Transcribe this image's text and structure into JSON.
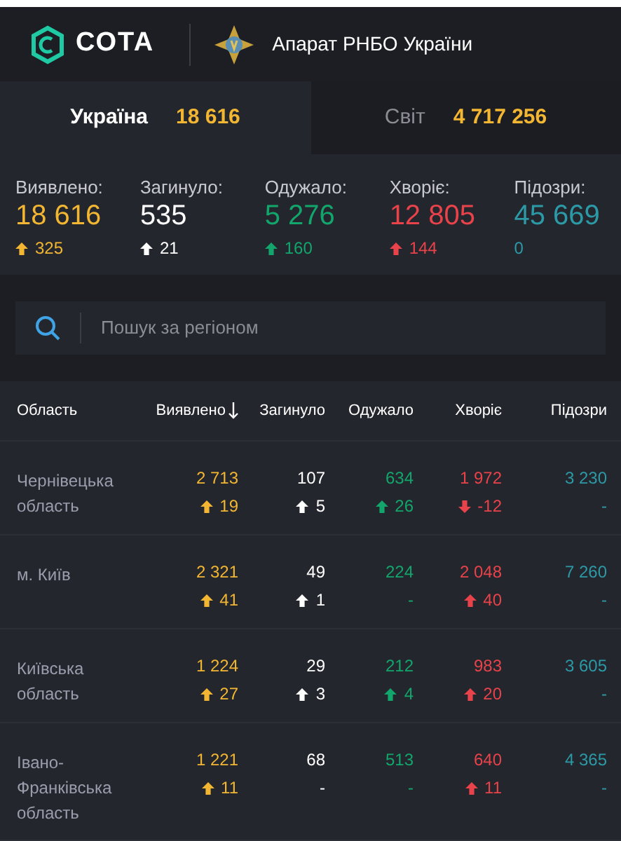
{
  "header": {
    "logo_text": "СОТА",
    "org": "Апарат РНБО України"
  },
  "tabs": [
    {
      "label": "Україна",
      "value": "18 616",
      "selected": true
    },
    {
      "label": "Світ",
      "value": "4 717 256",
      "selected": false
    }
  ],
  "stats": [
    {
      "label": "Виявлено:",
      "value": "18 616",
      "color": "#f2b632",
      "delta": {
        "text": "325",
        "kind": "up"
      }
    },
    {
      "label": "Загинуло:",
      "value": "535",
      "color": "#ffffff",
      "delta": {
        "text": "21",
        "kind": "up"
      }
    },
    {
      "label": "Одужало:",
      "value": "5 276",
      "color": "#12a66c",
      "delta": {
        "text": "160",
        "kind": "up"
      }
    },
    {
      "label": "Хворіє:",
      "value": "12 805",
      "color": "#e8424a",
      "delta": {
        "text": "144",
        "kind": "up"
      }
    },
    {
      "label": "Підозри:",
      "value": "45 669",
      "color": "#2c9aa6",
      "delta": {
        "text": "0",
        "kind": "none"
      }
    }
  ],
  "search": {
    "placeholder": "Пошук за регіоном"
  },
  "table": {
    "columns": [
      {
        "label": "Область",
        "sorted": false
      },
      {
        "label": "Виявлено",
        "sorted": true
      },
      {
        "label": "Загинуло",
        "sorted": false
      },
      {
        "label": "Одужало",
        "sorted": false
      },
      {
        "label": "Хворіє",
        "sorted": false
      },
      {
        "label": "Підозри",
        "sorted": false
      }
    ],
    "rows": [
      {
        "cells": [
          {
            "value": "Чернівецька область"
          },
          {
            "value": "2 713",
            "delta": {
              "text": "19",
              "kind": "up"
            }
          },
          {
            "value": "107",
            "delta": {
              "text": "5",
              "kind": "up"
            }
          },
          {
            "value": "634",
            "delta": {
              "text": "26",
              "kind": "up"
            }
          },
          {
            "value": "1 972",
            "delta": {
              "text": "-12",
              "kind": "down"
            }
          },
          {
            "value": "3 230",
            "delta": {
              "text": "-",
              "kind": "none"
            }
          }
        ]
      },
      {
        "cells": [
          {
            "value": "м. Київ"
          },
          {
            "value": "2 321",
            "delta": {
              "text": "41",
              "kind": "up"
            }
          },
          {
            "value": "49",
            "delta": {
              "text": "1",
              "kind": "up"
            }
          },
          {
            "value": "224",
            "delta": {
              "text": "-",
              "kind": "none"
            }
          },
          {
            "value": "2 048",
            "delta": {
              "text": "40",
              "kind": "up"
            }
          },
          {
            "value": "7 260",
            "delta": {
              "text": "-",
              "kind": "none"
            }
          }
        ]
      },
      {
        "cells": [
          {
            "value": "Київська область"
          },
          {
            "value": "1 224",
            "delta": {
              "text": "27",
              "kind": "up"
            }
          },
          {
            "value": "29",
            "delta": {
              "text": "3",
              "kind": "up"
            }
          },
          {
            "value": "212",
            "delta": {
              "text": "4",
              "kind": "up"
            }
          },
          {
            "value": "983",
            "delta": {
              "text": "20",
              "kind": "up"
            }
          },
          {
            "value": "3 605",
            "delta": {
              "text": "-",
              "kind": "none"
            }
          }
        ]
      },
      {
        "cells": [
          {
            "value": "Івано-Франківська область"
          },
          {
            "value": "1 221",
            "delta": {
              "text": "11",
              "kind": "up"
            }
          },
          {
            "value": "68",
            "delta": {
              "text": "-",
              "kind": "none"
            }
          },
          {
            "value": "513",
            "delta": {
              "text": "-",
              "kind": "none"
            }
          },
          {
            "value": "640",
            "delta": {
              "text": "11",
              "kind": "up"
            }
          },
          {
            "value": "4 365",
            "delta": {
              "text": "-",
              "kind": "none"
            }
          }
        ]
      }
    ]
  }
}
